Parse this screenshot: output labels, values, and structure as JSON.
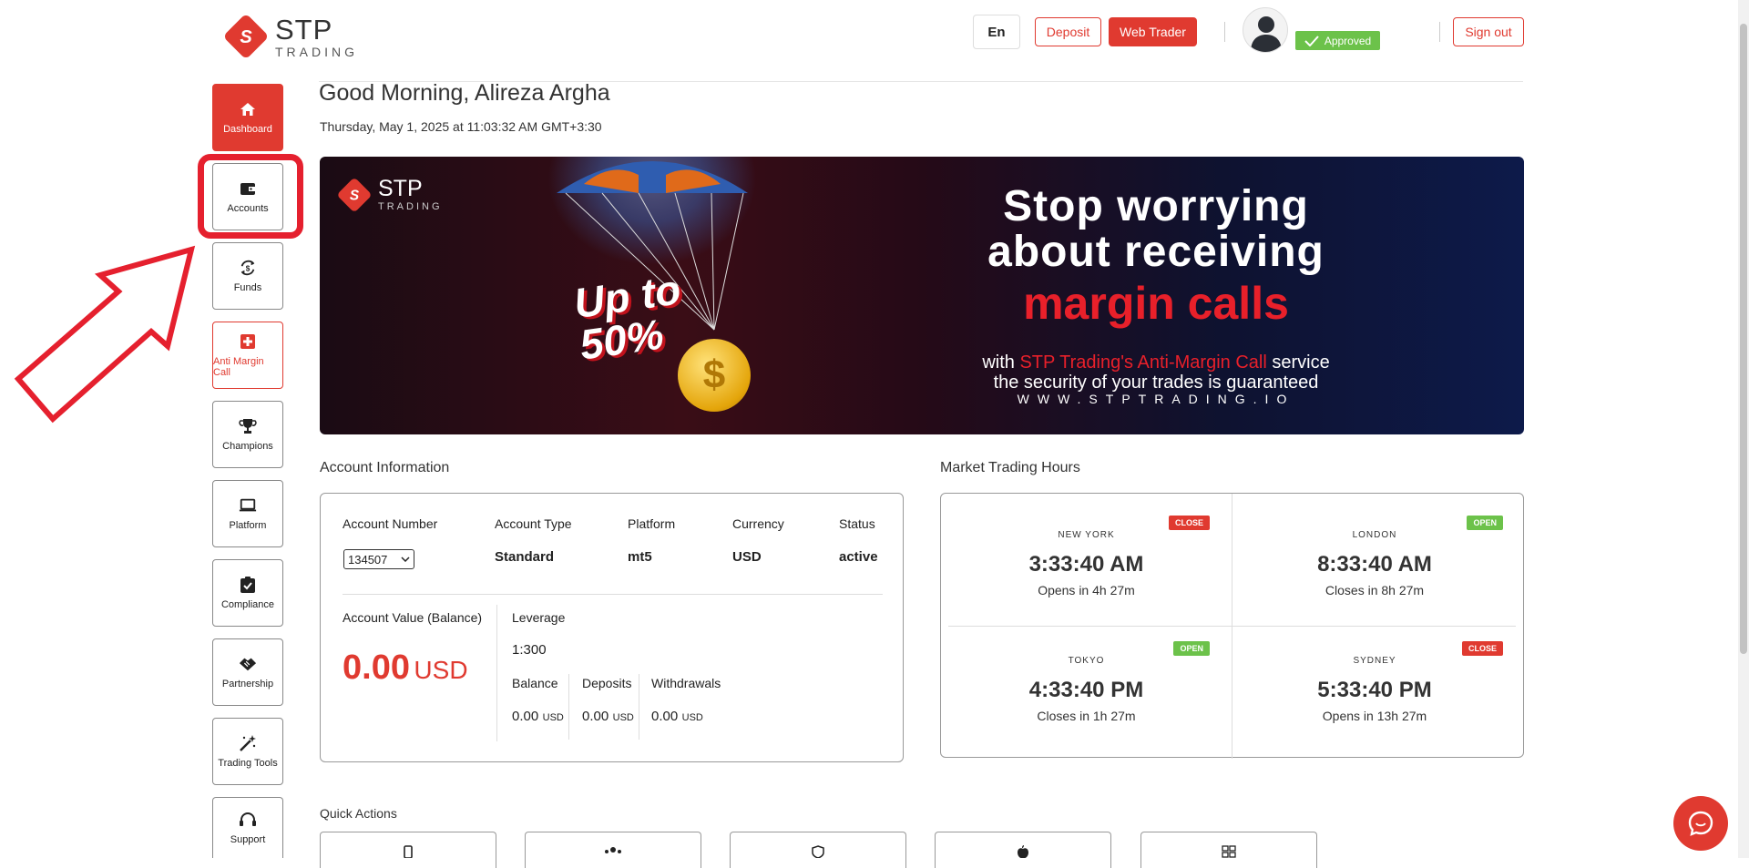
{
  "brand": {
    "name": "STP",
    "sub": "TRADING"
  },
  "header": {
    "lang": "En",
    "deposit": "Deposit",
    "web_trader": "Web Trader",
    "approved": "Approved",
    "sign_out": "Sign out"
  },
  "sidebar": {
    "items": [
      {
        "label": "Dashboard",
        "icon": "home-icon"
      },
      {
        "label": "Accounts",
        "icon": "wallet-icon"
      },
      {
        "label": "Funds",
        "icon": "funds-exchange-icon"
      },
      {
        "label": "Anti Margin Call",
        "icon": "plus-square-icon"
      },
      {
        "label": "Champions",
        "icon": "trophy-icon"
      },
      {
        "label": "Platform",
        "icon": "laptop-icon"
      },
      {
        "label": "Compliance",
        "icon": "clipboard-check-icon"
      },
      {
        "label": "Partnership",
        "icon": "handshake-icon"
      },
      {
        "label": "Trading Tools",
        "icon": "magic-wand-icon"
      },
      {
        "label": "Support",
        "icon": "headset-icon"
      }
    ]
  },
  "greeting": {
    "title": "Good Morning, Alireza Argha",
    "date": "Thursday, May 1, 2025 at 11:03:32 AM GMT+3:30"
  },
  "banner": {
    "brand": "STP",
    "brand_sub": "TRADING",
    "headline_1": "Stop worrying",
    "headline_2": "about receiving",
    "headline_3": "margin calls",
    "promo_1": "Up to",
    "promo_2": "50%",
    "body_pre": "with ",
    "body_highlight": "STP Trading's Anti-Margin Call",
    "body_post": " service",
    "body_line2": "the security of your trades is guaranteed",
    "url": "WWW.STPTRADING.IO"
  },
  "account_info": {
    "title": "Account Information",
    "headers": [
      "Account Number",
      "Account Type",
      "Platform",
      "Currency",
      "Status"
    ],
    "account_number": "134507",
    "account_type": "Standard",
    "platform": "mt5",
    "currency": "USD",
    "status": "active",
    "value_label": "Account Value (Balance)",
    "value": "0.00",
    "value_unit": "USD",
    "leverage_label": "Leverage",
    "leverage": "1:300",
    "balance_label": "Balance",
    "balance": "0.00",
    "deposits_label": "Deposits",
    "deposits": "0.00",
    "withdrawals_label": "Withdrawals",
    "withdrawals": "0.00",
    "unit": "USD"
  },
  "market": {
    "title": "Market Trading Hours",
    "cities": [
      {
        "name": "NEW YORK",
        "time": "3:33:40 AM",
        "note": "Opens in 4h 27m",
        "tag": "CLOSE"
      },
      {
        "name": "LONDON",
        "time": "8:33:40 AM",
        "note": "Closes in 8h 27m",
        "tag": "OPEN"
      },
      {
        "name": "TOKYO",
        "time": "4:33:40 PM",
        "note": "Closes in 1h 27m",
        "tag": "OPEN"
      },
      {
        "name": "SYDNEY",
        "time": "5:33:40 PM",
        "note": "Opens in 13h 27m",
        "tag": "CLOSE"
      }
    ]
  },
  "quick_actions": {
    "title": "Quick Actions",
    "icons": [
      "mobile-icon",
      "users-icon",
      "shield-icon",
      "apple-icon",
      "windows-icon"
    ]
  },
  "colors": {
    "accent": "#e03a30",
    "open": "#6cc24a",
    "highlight": "#e5202e"
  }
}
